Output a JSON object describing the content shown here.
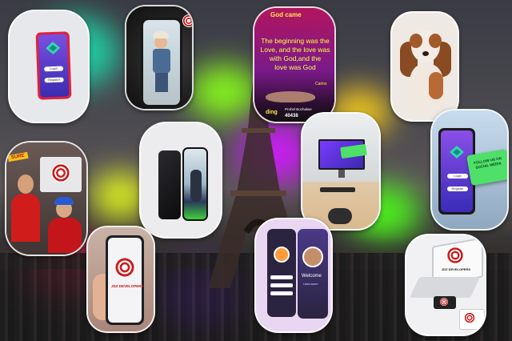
{
  "background": {
    "scene": "eiffel-tower-dusk",
    "glow_colors": [
      "#1fd6a8",
      "#8aff1a",
      "#d21aff",
      "#ff1a55",
      "#e9ff1a",
      "#7a2aff",
      "#ffd21a",
      "#4dff1a"
    ]
  },
  "tiles": [
    {
      "name": "login-app-mockup-tile",
      "login_button": "Login",
      "register_button": "Register"
    },
    {
      "name": "phone-child-photo-tile"
    },
    {
      "name": "scripture-lyrics-tile",
      "header_text": "God came",
      "lines": [
        "The beginning was the",
        "Love, and the love was",
        "with God,and the",
        "love was God"
      ],
      "author": "Carlos",
      "footer_name": "Prohel Bochalwe",
      "footer_number": "40438",
      "footer_prefix": "ding"
    },
    {
      "name": "spaniel-dog-photo-tile"
    },
    {
      "name": "red-ring-logo-developers-tile",
      "banner_text": "SURE"
    },
    {
      "name": "two-phones-mockup-tile"
    },
    {
      "name": "desk-monitor-mockup-tile"
    },
    {
      "name": "login-app-popup-tile",
      "login_button": "Login",
      "register_button": "Register",
      "popup_text": "FOLLOW US ON SOCIAL MEDIA"
    },
    {
      "name": "jdz-developers-phone-tile",
      "brand": "JDZ DEVELOPERS"
    },
    {
      "name": "welcome-login-app-tile",
      "welcome_text": "Welcome",
      "username": "Username"
    },
    {
      "name": "laptop-logo-mockup-tile",
      "brand": "JDZ DEVELOPERS"
    }
  ]
}
